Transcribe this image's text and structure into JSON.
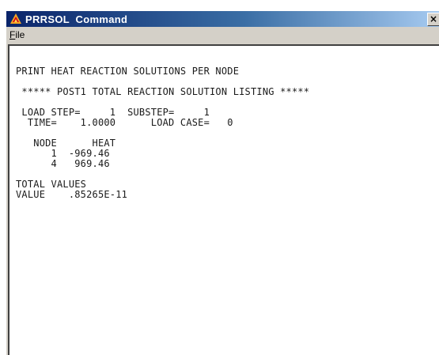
{
  "window": {
    "title": "PRRSOL  Command",
    "close_label": "×",
    "icon": "ansys-logo-icon"
  },
  "menu": {
    "items": [
      {
        "mnemonic": "F",
        "rest": "ile"
      }
    ]
  },
  "output_lines": [
    "PRINT HEAT REACTION SOLUTIONS PER NODE",
    "",
    " ***** POST1 TOTAL REACTION SOLUTION LISTING *****",
    "",
    " LOAD STEP=     1  SUBSTEP=     1",
    "  TIME=    1.0000      LOAD CASE=   0",
    "",
    "   NODE      HEAT",
    "      1  -969.46",
    "      4   969.46",
    "",
    "TOTAL VALUES",
    "VALUE    .85265E-11"
  ]
}
